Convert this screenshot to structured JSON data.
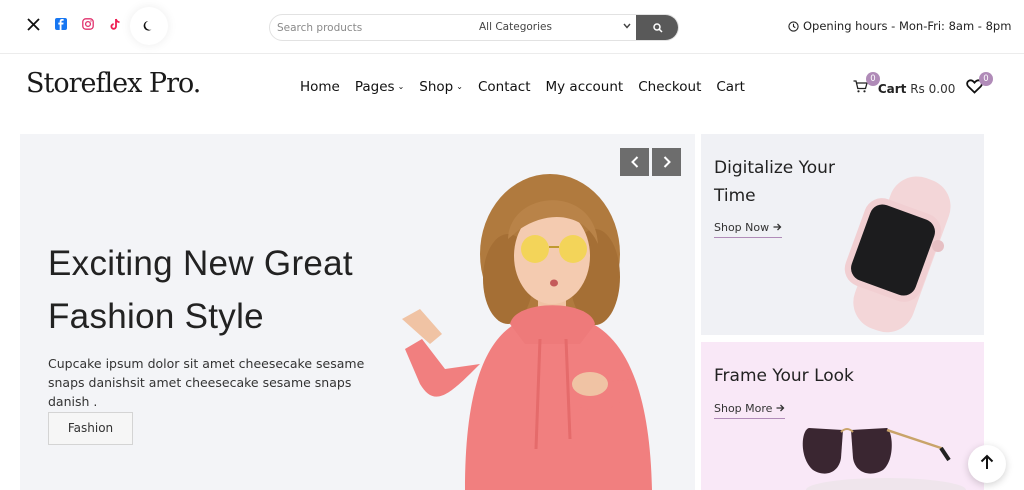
{
  "social": [
    {
      "icon": "x-twitter-icon",
      "color": "#111111"
    },
    {
      "icon": "facebook-icon",
      "color": "#1877f2"
    },
    {
      "icon": "instagram-icon",
      "color": "#e1306c"
    },
    {
      "icon": "tiktok-icon",
      "color": "#ee1d52"
    }
  ],
  "theme_toggle": {
    "icon": "moon-icon"
  },
  "search": {
    "placeholder": "Search products",
    "category": "All Categories",
    "button_icon": "search-icon"
  },
  "hours": {
    "text": "Opening hours - Mon-Fri: 8am - 8pm"
  },
  "logo": {
    "text": "Storeflex Pro."
  },
  "nav": {
    "home": "Home",
    "pages": "Pages",
    "shop": "Shop",
    "contact": "Contact",
    "account": "My account",
    "checkout": "Checkout",
    "cart": "Cart"
  },
  "cart": {
    "label": "Cart",
    "amount": "Rs 0.00",
    "count": "0"
  },
  "wishlist": {
    "count": "0"
  },
  "hero": {
    "title": "Exciting New Great Fashion Style",
    "description": "Cupcake ipsum dolor sit amet cheesecake sesame snaps danishsit amet cheesecake sesame snaps danish .",
    "button": "Fashion"
  },
  "banners": [
    {
      "title": "Digitalize Your Time",
      "link": "Shop Now"
    },
    {
      "title": "Frame Your Look",
      "link": "Shop More"
    }
  ],
  "colors": {
    "accent": "#b08bb8",
    "dark_button": "#595959"
  }
}
